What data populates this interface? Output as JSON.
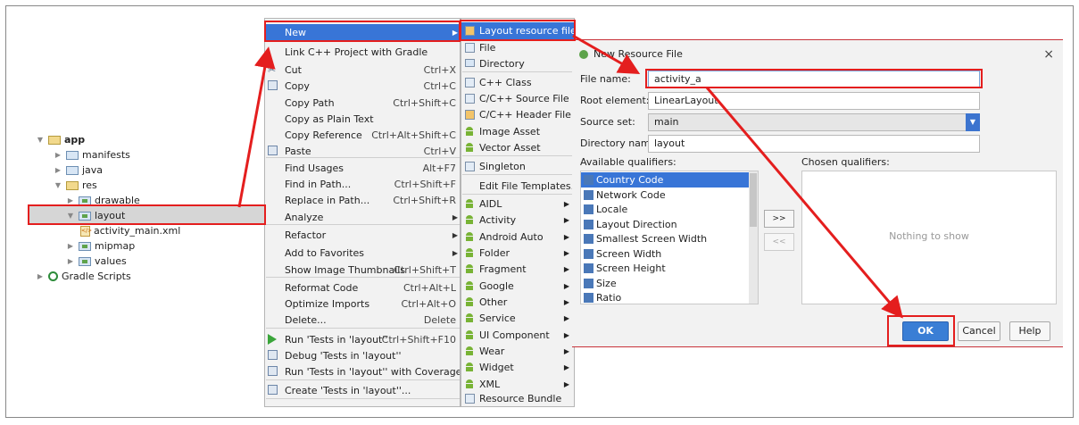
{
  "project_tree": {
    "items": [
      {
        "label": "app",
        "level": 0,
        "expanded": true,
        "bold": true
      },
      {
        "label": "manifests",
        "level": 1,
        "expanded": false
      },
      {
        "label": "java",
        "level": 1,
        "expanded": false
      },
      {
        "label": "res",
        "level": 1,
        "expanded": true
      },
      {
        "label": "drawable",
        "level": 2,
        "expanded": false
      },
      {
        "label": "layout",
        "level": 2,
        "expanded": true,
        "selected": true
      },
      {
        "label": "activity_main.xml",
        "level": 3
      },
      {
        "label": "mipmap",
        "level": 2,
        "expanded": false
      },
      {
        "label": "values",
        "level": 2,
        "expanded": false
      },
      {
        "label": "Gradle Scripts",
        "level": 0,
        "expanded": false
      }
    ]
  },
  "context_menu": {
    "items": [
      {
        "label": "New",
        "submenu": true,
        "active": true
      },
      {
        "label": "Link C++ Project with Gradle"
      },
      {
        "label": "Cut",
        "shortcut": "Ctrl+X",
        "icon": "scissors-icon"
      },
      {
        "label": "Copy",
        "shortcut": "Ctrl+C",
        "icon": "copy-icon"
      },
      {
        "label": "Copy Path",
        "shortcut": "Ctrl+Shift+C"
      },
      {
        "label": "Copy as Plain Text"
      },
      {
        "label": "Copy Reference",
        "shortcut": "Ctrl+Alt+Shift+C"
      },
      {
        "label": "Paste",
        "shortcut": "Ctrl+V",
        "icon": "paste-icon"
      },
      {
        "label": "Find Usages",
        "shortcut": "Alt+F7"
      },
      {
        "label": "Find in Path...",
        "shortcut": "Ctrl+Shift+F"
      },
      {
        "label": "Replace in Path...",
        "shortcut": "Ctrl+Shift+R"
      },
      {
        "label": "Analyze",
        "submenu": true
      },
      {
        "label": "Refactor",
        "submenu": true
      },
      {
        "label": "Add to Favorites",
        "submenu": true
      },
      {
        "label": "Show Image Thumbnails",
        "shortcut": "Ctrl+Shift+T"
      },
      {
        "label": "Reformat Code",
        "shortcut": "Ctrl+Alt+L"
      },
      {
        "label": "Optimize Imports",
        "shortcut": "Ctrl+Alt+O"
      },
      {
        "label": "Delete...",
        "shortcut": "Delete"
      },
      {
        "label": "Run 'Tests in 'layout''",
        "shortcut": "Ctrl+Shift+F10",
        "icon": "run-icon"
      },
      {
        "label": "Debug 'Tests in 'layout''",
        "icon": "debug-icon"
      },
      {
        "label": "Run 'Tests in 'layout'' with Coverage",
        "icon": "coverage-icon"
      },
      {
        "label": "Create 'Tests in 'layout''...",
        "icon": "test-icon"
      }
    ]
  },
  "new_submenu": {
    "items": [
      {
        "label": "Layout resource file",
        "active": true,
        "icon": "layout-file-icon"
      },
      {
        "label": "File",
        "icon": "file-icon"
      },
      {
        "label": "Directory",
        "icon": "folder-icon"
      },
      {
        "label": "C++ Class",
        "icon": "cpp-class-icon"
      },
      {
        "label": "C/C++ Source File",
        "icon": "cpp-source-icon"
      },
      {
        "label": "C/C++ Header File",
        "icon": "cpp-header-icon"
      },
      {
        "label": "Image Asset",
        "icon": "android-icon"
      },
      {
        "label": "Vector Asset",
        "icon": "android-icon"
      },
      {
        "label": "Singleton",
        "icon": "singleton-icon"
      },
      {
        "label": "Edit File Templates..."
      },
      {
        "label": "AIDL",
        "icon": "android-icon",
        "submenu": true
      },
      {
        "label": "Activity",
        "icon": "android-icon",
        "submenu": true
      },
      {
        "label": "Android Auto",
        "icon": "android-icon",
        "submenu": true
      },
      {
        "label": "Folder",
        "icon": "android-icon",
        "submenu": true
      },
      {
        "label": "Fragment",
        "icon": "android-icon",
        "submenu": true
      },
      {
        "label": "Google",
        "icon": "android-icon",
        "submenu": true
      },
      {
        "label": "Other",
        "icon": "android-icon",
        "submenu": true
      },
      {
        "label": "Service",
        "icon": "android-icon",
        "submenu": true
      },
      {
        "label": "UI Component",
        "icon": "android-icon",
        "submenu": true
      },
      {
        "label": "Wear",
        "icon": "android-icon",
        "submenu": true
      },
      {
        "label": "Widget",
        "icon": "android-icon",
        "submenu": true
      },
      {
        "label": "XML",
        "icon": "android-icon",
        "submenu": true
      },
      {
        "label": "Resource Bundle",
        "icon": "resource-bundle-icon"
      }
    ]
  },
  "dialog": {
    "title": "New Resource File",
    "close": "×",
    "file_name_label": "File name:",
    "file_name_value": "activity_a",
    "root_element_label": "Root element:",
    "root_element_value": "LinearLayout",
    "source_set_label": "Source set:",
    "source_set_value": "main",
    "directory_name_label": "Directory name:",
    "directory_name_value": "layout",
    "available_label": "Available qualifiers:",
    "chosen_label": "Chosen qualifiers:",
    "qualifiers": [
      "Country Code",
      "Network Code",
      "Locale",
      "Layout Direction",
      "Smallest Screen Width",
      "Screen Width",
      "Screen Height",
      "Size",
      "Ratio"
    ],
    "add_button": ">>",
    "remove_button": "<<",
    "empty_text": "Nothing to show",
    "ok": "OK",
    "cancel": "Cancel",
    "help": "Help"
  },
  "colors": {
    "accent": "#3875d7",
    "annotation": "#e41e1e"
  }
}
